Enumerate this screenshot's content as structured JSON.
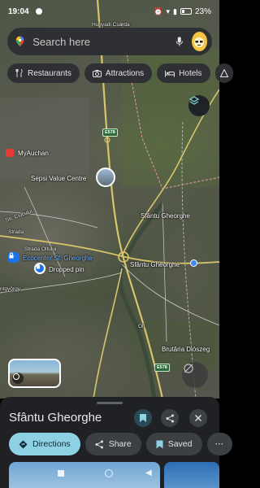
{
  "status_bar": {
    "time": "19:04",
    "battery": "23%"
  },
  "search": {
    "placeholder": "Search here"
  },
  "chips": [
    {
      "label": "Restaurants",
      "icon": "fork-knife-icon"
    },
    {
      "label": "Attractions",
      "icon": "camera-icon"
    },
    {
      "label": "Hotels",
      "icon": "bed-icon"
    }
  ],
  "map": {
    "labels": {
      "hunyadi": "Hunyadi Csárda",
      "myauchan": "MyAuchan",
      "sepsi": "Sepsi Value Centre",
      "sfantu1": "Sfântu Gheorghe",
      "sfantu2": "Sfântu Gheorghe",
      "str_ciucului": "Str. Ciucului",
      "strada_oltului": "Strada Oltului",
      "strada": "Strada",
      "ecocenter": "Ecocenter Sf. Gheorghe",
      "dropped_pin": "Dropped pin",
      "ntgyorgy": "ntgyörgy",
      "olt": "Olt",
      "brutaria": "Brutăria Diószeg",
      "e578_a": "E578",
      "e578_b": "E578"
    }
  },
  "sheet": {
    "title": "Sfântu Gheorghe",
    "actions": {
      "directions": "Directions",
      "share": "Share",
      "saved": "Saved"
    }
  },
  "colors": {
    "accent": "#8ed1e4",
    "sheet_bg": "#202124",
    "pin_blue": "#1a73e8"
  }
}
